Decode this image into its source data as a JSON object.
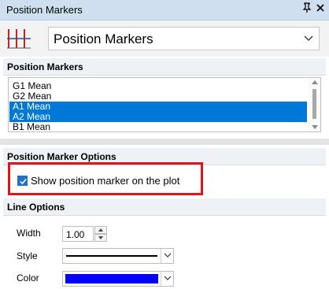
{
  "window": {
    "title": "Position Markers",
    "pin_glyph": "ᵘ̸",
    "close_glyph": "✕"
  },
  "selector": {
    "value": "Position Markers"
  },
  "markers_section": {
    "title": "Position Markers",
    "items": [
      {
        "label": "G1 Mean",
        "selected": false
      },
      {
        "label": "G2 Mean",
        "selected": false
      },
      {
        "label": "A1 Mean",
        "selected": true
      },
      {
        "label": "A2 Mean",
        "selected": true
      },
      {
        "label": "B1 Mean",
        "selected": false
      }
    ]
  },
  "options_section": {
    "title": "Position Marker Options",
    "show_marker_label": "Show position marker on the plot",
    "show_marker_checked": true
  },
  "line_options": {
    "title": "Line Options",
    "width_label": "Width",
    "width_value": "1.00",
    "style_label": "Style",
    "style_value": "solid",
    "color_label": "Color",
    "color_value": "#0000ff"
  },
  "colors": {
    "titlebar": "#cfdff0",
    "selection": "#0078d7",
    "highlight": "#e1141c",
    "checkbox": "#1e73c8"
  }
}
